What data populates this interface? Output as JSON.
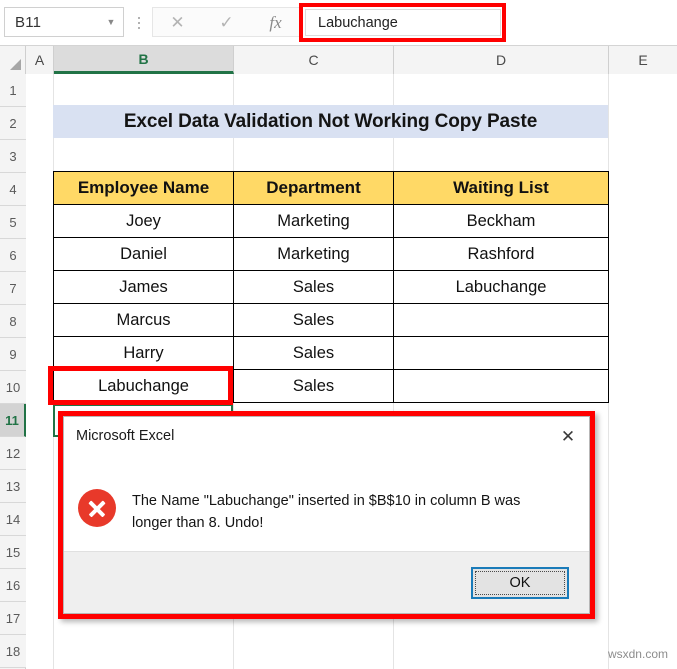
{
  "formula_bar": {
    "name_box_value": "B11",
    "name_box_arrow": "▼",
    "cancel_icon": "✕",
    "enter_icon": "✓",
    "function_icon": "fx",
    "formula_value": "Labuchange"
  },
  "grid": {
    "column_headers": [
      "A",
      "B",
      "C",
      "D",
      "E"
    ],
    "active_column": "B",
    "row_headers": [
      "1",
      "2",
      "3",
      "4",
      "5",
      "6",
      "7",
      "8",
      "9",
      "10",
      "11",
      "12",
      "13",
      "14",
      "15",
      "16",
      "17",
      "18"
    ],
    "active_row": "11"
  },
  "title_banner": {
    "text": "Excel Data Validation Not Working Copy Paste"
  },
  "table": {
    "headers": [
      "Employee Name",
      "Department",
      "Waiting List"
    ],
    "rows": [
      [
        "Joey",
        "Marketing",
        "Beckham"
      ],
      [
        "Daniel",
        "Marketing",
        "Rashford"
      ],
      [
        "James",
        "Sales",
        "Labuchange"
      ],
      [
        "Marcus",
        "Sales",
        ""
      ],
      [
        "Harry",
        "Sales",
        ""
      ],
      [
        "Labuchange",
        "Sales",
        ""
      ]
    ],
    "header_fill": "#ffd966"
  },
  "dialog": {
    "title": "Microsoft Excel",
    "close_icon": "✕",
    "error_icon": "error-x-icon",
    "message": "The Name \"Labuchange\" inserted in $B$10 in column B was longer than 8. Undo!",
    "ok_label": "OK"
  },
  "watermark": {
    "text": "wsxdn.com"
  },
  "colors": {
    "highlight_red": "#ff0000",
    "excel_green": "#217346",
    "error_red": "#e8392a",
    "banner_blue": "#d9e1f2"
  }
}
